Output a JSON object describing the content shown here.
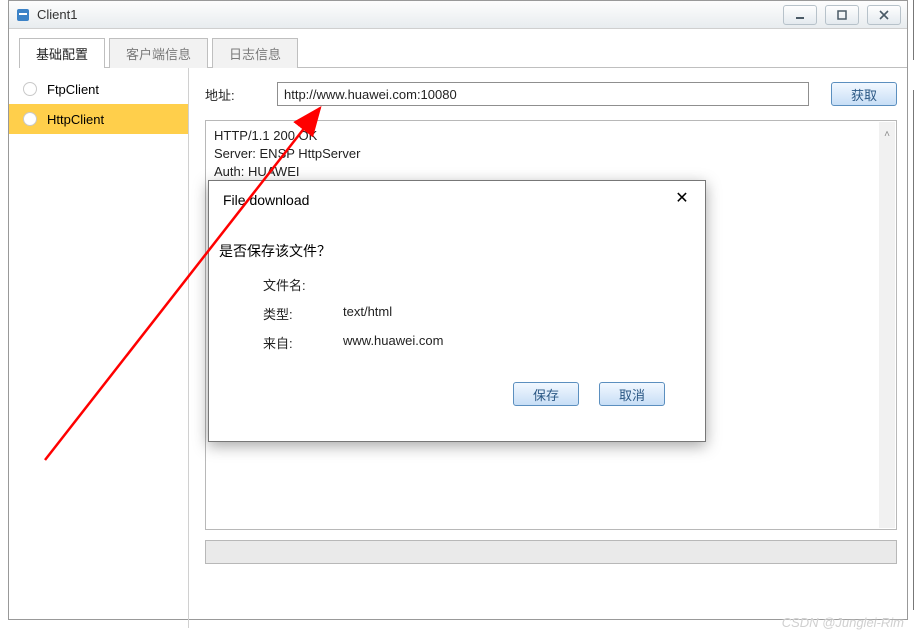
{
  "window": {
    "title": "Client1"
  },
  "tabs": [
    {
      "label": "基础配置",
      "active": true
    },
    {
      "label": "客户端信息",
      "active": false
    },
    {
      "label": "日志信息",
      "active": false
    }
  ],
  "sidebar": {
    "items": [
      {
        "label": "FtpClient",
        "active": false
      },
      {
        "label": "HttpClient",
        "active": true
      }
    ]
  },
  "address": {
    "label": "地址:",
    "value": "http://www.huawei.com:10080",
    "fetch_label": "获取"
  },
  "response": {
    "line1": "HTTP/1.1 200 OK",
    "line2": "Server: ENSP HttpServer",
    "line3": "Auth: HUAWEI"
  },
  "dialog": {
    "title": "File download",
    "question": "是否保存该文件？",
    "filename_label": "文件名:",
    "filename_value": "",
    "type_label": "类型:",
    "type_value": "text/html",
    "from_label": "来自:",
    "from_value": "www.huawei.com",
    "save_label": "保存",
    "cancel_label": "取消"
  },
  "watermark": "CSDN @Junglei-Rim"
}
